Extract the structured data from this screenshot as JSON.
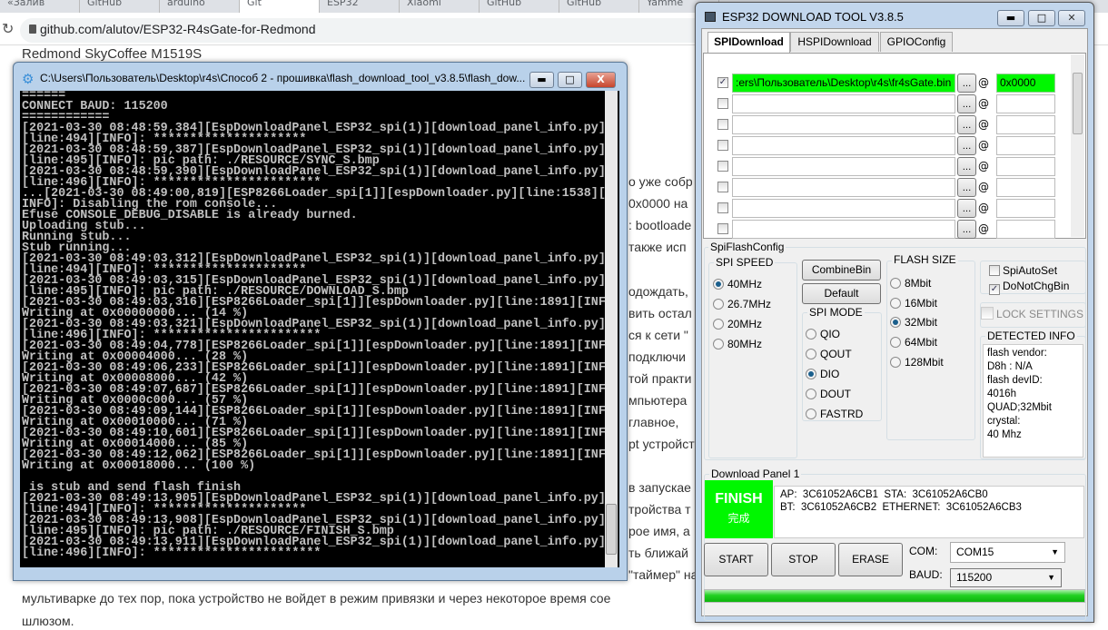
{
  "browser": {
    "tabs": [
      "«Залив",
      "GitHub",
      "arduino",
      "Git",
      "ESP32",
      "Xiaomi",
      "GitHub",
      "GitHub",
      "Yamme"
    ],
    "url": "github.com/alutov/ESP32-R4sGate-for-Redmond"
  },
  "article": {
    "heading": "Redmond SkyCoffee M1519S",
    "fragments": [
      "о уже собр",
      "0x0000 на",
      ": bootloade",
      "также исп",
      "одождать,",
      "вить остал",
      "ся к сети \"",
      "подключи",
      "той практи",
      "мпьютера",
      "главное,",
      "pt устройст",
      "в запускае",
      "тройства т",
      "рое имя, а",
      "ть ближай",
      "\"таймер\" на"
    ],
    "line_bottom_1": "мультиварке до тех пор, пока устройство не войдет в режим привязки и через некоторое время сое",
    "line_bottom_2": "шлюзом."
  },
  "console": {
    "title": "C:\\Users\\Пользователь\\Desktop\\r4s\\Способ 2 - прошивка\\flash_download_tool_v3.8.5\\flash_dow...",
    "lines": [
      "======",
      "CONNECT BAUD: 115200",
      "============",
      "[2021-03-30 08:48:59,384][EspDownloadPanel_ESP32_spi(1)][download_panel_info.py]",
      "[line:494][INFO]: *********************",
      "[2021-03-30 08:48:59,387][EspDownloadPanel_ESP32_spi(1)][download_panel_info.py]",
      "[line:495][INFO]: pic path: ./RESOURCE/SYNC_S.bmp",
      "[2021-03-30 08:48:59,390][EspDownloadPanel_ESP32_spi(1)][download_panel_info.py]",
      "[line:496][INFO]: ***********************",
      "...[2021-03-30 08:49:00,819][ESP8266Loader_spi[1]][espDownloader.py][line:1538][",
      "INFO]: Disabling the rom console...",
      "Efuse CONSOLE_DEBUG_DISABLE is already burned.",
      "Uploading stub...",
      "Running stub...",
      "Stub running...",
      "[2021-03-30 08:49:03,312][EspDownloadPanel_ESP32_spi(1)][download_panel_info.py]",
      "[line:494][INFO]: *********************",
      "[2021-03-30 08:49:03,315][EspDownloadPanel_ESP32_spi(1)][download_panel_info.py]",
      "[line:495][INFO]: pic path: ./RESOURCE/DOWNLOAD_S.bmp",
      "[2021-03-30 08:49:03,316][ESP8266Loader_spi[1]][espDownloader.py][line:1891][INF",
      "Writing at 0x00000000... (14 %)",
      "[2021-03-30 08:49:03,321][EspDownloadPanel_ESP32_spi(1)][download_panel_info.py]",
      "[line:496][INFO]: ***********************",
      "[2021-03-30 08:49:04,778][ESP8266Loader_spi[1]][espDownloader.py][line:1891][INF",
      "Writing at 0x00004000... (28 %)",
      "[2021-03-30 08:49:06,233][ESP8266Loader_spi[1]][espDownloader.py][line:1891][INF",
      "Writing at 0x00008000... (42 %)",
      "[2021-03-30 08:49:07,687][ESP8266Loader_spi[1]][espDownloader.py][line:1891][INF",
      "Writing at 0x0000c000... (57 %)",
      "[2021-03-30 08:49:09,144][ESP8266Loader_spi[1]][espDownloader.py][line:1891][INF",
      "Writing at 0x00010000... (71 %)",
      "[2021-03-30 08:49:10,601][ESP8266Loader_spi[1]][espDownloader.py][line:1891][INF",
      "Writing at 0x00014000... (85 %)",
      "[2021-03-30 08:49:12,062][ESP8266Loader_spi[1]][espDownloader.py][line:1891][INF",
      "Writing at 0x00018000... (100 %)",
      "",
      " is stub and send flash finish",
      "[2021-03-30 08:49:13,905][EspDownloadPanel_ESP32_spi(1)][download_panel_info.py]",
      "[line:494][INFO]: *********************",
      "[2021-03-30 08:49:13,908][EspDownloadPanel_ESP32_spi(1)][download_panel_info.py]",
      "[line:495][INFO]: pic path: ./RESOURCE/FINISH_S.bmp",
      "[2021-03-30 08:49:13,911][EspDownloadPanel_ESP32_spi(1)][download_panel_info.py]",
      "[line:496][INFO]: ***********************"
    ]
  },
  "tool": {
    "title": "ESP32 DOWNLOAD TOOL V3.8.5",
    "tabs": [
      "SPIDownload",
      "HSPIDownload",
      "GPIOConfig"
    ],
    "files": [
      {
        "checked": true,
        "path": ":ers\\Пользователь\\Desktop\\r4s\\fr4sGate.bin",
        "addr": "0x0000"
      },
      {
        "checked": false,
        "path": "",
        "addr": ""
      },
      {
        "checked": false,
        "path": "",
        "addr": ""
      },
      {
        "checked": false,
        "path": "",
        "addr": ""
      },
      {
        "checked": false,
        "path": "",
        "addr": ""
      },
      {
        "checked": false,
        "path": "",
        "addr": ""
      },
      {
        "checked": false,
        "path": "",
        "addr": ""
      },
      {
        "checked": false,
        "path": "",
        "addr": ""
      }
    ],
    "browse_label": "...",
    "at_label": "@",
    "spiflashconfig_label": "SpiFlashConfig",
    "spi_speed": {
      "label": "SPI SPEED",
      "options": [
        "40MHz",
        "26.7MHz",
        "20MHz",
        "80MHz"
      ],
      "selected": "40MHz"
    },
    "combine_label": "CombineBin",
    "default_label": "Default",
    "spi_mode": {
      "label": "SPI MODE",
      "options": [
        "QIO",
        "QOUT",
        "DIO",
        "DOUT",
        "FASTRD"
      ],
      "selected": "DIO"
    },
    "flash_size": {
      "label": "FLASH SIZE",
      "options": [
        "8Mbit",
        "16Mbit",
        "32Mbit",
        "64Mbit",
        "128Mbit"
      ],
      "selected": "32Mbit"
    },
    "spi_auto_set": {
      "label": "SpiAutoSet",
      "checked": false
    },
    "do_not_chg_bin": {
      "label": "DoNotChgBin",
      "checked": true
    },
    "lock_settings": {
      "label": "LOCK SETTINGS",
      "checked": false
    },
    "detected_info": {
      "label": "DETECTED INFO",
      "lines": [
        "flash vendor:",
        "D8h : N/A",
        "flash devID:",
        "4016h",
        "QUAD;32Mbit",
        "crystal:",
        "40 Mhz"
      ]
    },
    "download_panel": {
      "label": "Download Panel 1",
      "status": "FINISH",
      "status_cn": "完成",
      "mac_line1": "AP:  3C61052A6CB1  STA:  3C61052A6CB0",
      "mac_line2": "BT:  3C61052A6CB2  ETHERNET:  3C61052A6CB3",
      "start_label": "START",
      "stop_label": "STOP",
      "erase_label": "ERASE",
      "com_label": "COM:",
      "com_value": "COM15",
      "baud_label": "BAUD:",
      "baud_value": "115200",
      "progress_percent": 100
    },
    "colors": {
      "success": "#00f700"
    }
  }
}
